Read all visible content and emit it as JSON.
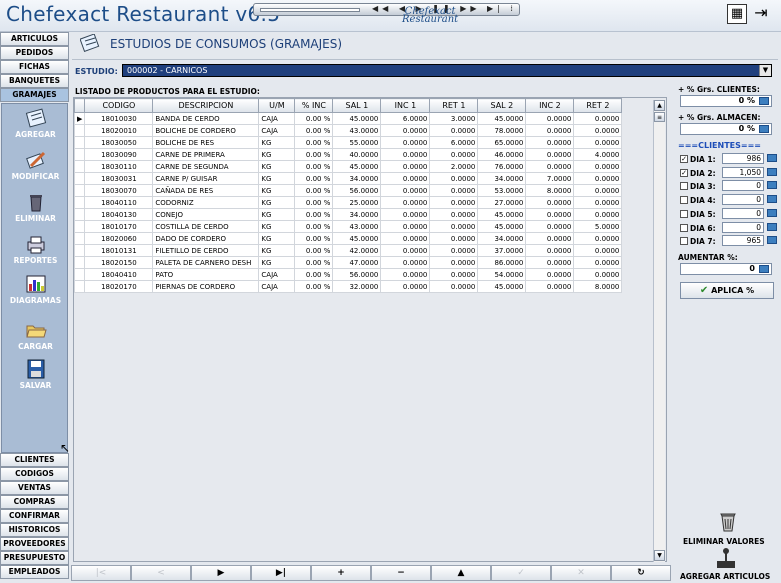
{
  "app": {
    "title": "Chefexact Restaurant v6.5",
    "logo": "Chefexact\nRestaurant"
  },
  "nav_top": [
    "ARTICULOS",
    "PEDIDOS",
    "FICHAS",
    "BANQUETES",
    "GRAMAJES"
  ],
  "nav_active": "GRAMAJES",
  "tools": [
    "AGREGAR",
    "MODIFICAR",
    "ELIMINAR",
    "REPORTES",
    "DIAGRAMAS",
    "CARGAR",
    "SALVAR"
  ],
  "nav_bottom": [
    "CLIENTES",
    "CODIGOS",
    "VENTAS",
    "COMPRAS",
    "CONFIRMAR",
    "HISTORICOS",
    "PROVEEDORES",
    "PRESUPUESTO",
    "EMPLEADOS"
  ],
  "screen": {
    "title": "ESTUDIOS DE CONSUMOS (GRAMAJES)",
    "estudio_label": "ESTUDIO:",
    "estudio_value": "000002 - CARNICOS",
    "listado_label": "LISTADO DE PRODUCTOS PARA EL ESTUDIO:"
  },
  "grid": {
    "columns": [
      "CODIGO",
      "DESCRIPCION",
      "U/M",
      "% INC",
      "SAL 1",
      "INC 1",
      "RET 1",
      "SAL 2",
      "INC 2",
      "RET 2"
    ],
    "rows": [
      [
        "18010030",
        "BANDA DE CERDO",
        "CAJA",
        "0.00 %",
        "45.0000",
        "6.0000",
        "3.0000",
        "45.0000",
        "0.0000",
        "0.0000"
      ],
      [
        "18020010",
        "BOLICHE DE CORDERO",
        "CAJA",
        "0.00 %",
        "43.0000",
        "0.0000",
        "0.0000",
        "78.0000",
        "0.0000",
        "0.0000"
      ],
      [
        "18030050",
        "BOLICHE DE RES",
        "KG",
        "0.00 %",
        "55.0000",
        "0.0000",
        "6.0000",
        "65.0000",
        "0.0000",
        "0.0000"
      ],
      [
        "18030090",
        "CARNE DE PRIMERA",
        "KG",
        "0.00 %",
        "40.0000",
        "0.0000",
        "0.0000",
        "46.0000",
        "0.0000",
        "4.0000"
      ],
      [
        "18030110",
        "CARNE DE SEGUNDA",
        "KG",
        "0.00 %",
        "45.0000",
        "0.0000",
        "2.0000",
        "76.0000",
        "0.0000",
        "0.0000"
      ],
      [
        "18030031",
        "CARNE P/ GUISAR",
        "KG",
        "0.00 %",
        "34.0000",
        "0.0000",
        "0.0000",
        "34.0000",
        "7.0000",
        "0.0000"
      ],
      [
        "18030070",
        "CAÑADA DE RES",
        "KG",
        "0.00 %",
        "56.0000",
        "0.0000",
        "0.0000",
        "53.0000",
        "8.0000",
        "0.0000"
      ],
      [
        "18040110",
        "CODORNIZ",
        "KG",
        "0.00 %",
        "25.0000",
        "0.0000",
        "0.0000",
        "27.0000",
        "0.0000",
        "0.0000"
      ],
      [
        "18040130",
        "CONEJO",
        "KG",
        "0.00 %",
        "34.0000",
        "0.0000",
        "0.0000",
        "45.0000",
        "0.0000",
        "0.0000"
      ],
      [
        "18010170",
        "COSTILLA DE CERDO",
        "KG",
        "0.00 %",
        "43.0000",
        "0.0000",
        "0.0000",
        "45.0000",
        "0.0000",
        "5.0000"
      ],
      [
        "18020060",
        "DADO DE CORDERO",
        "KG",
        "0.00 %",
        "45.0000",
        "0.0000",
        "0.0000",
        "34.0000",
        "0.0000",
        "0.0000"
      ],
      [
        "18010131",
        "FILETILLO DE CERDO",
        "KG",
        "0.00 %",
        "42.0000",
        "0.0000",
        "0.0000",
        "37.0000",
        "0.0000",
        "0.0000"
      ],
      [
        "18020150",
        "PALETA DE CARNERO DESH",
        "KG",
        "0.00 %",
        "47.0000",
        "0.0000",
        "0.0000",
        "86.0000",
        "0.0000",
        "0.0000"
      ],
      [
        "18040410",
        "PATO",
        "CAJA",
        "0.00 %",
        "56.0000",
        "0.0000",
        "0.0000",
        "54.0000",
        "0.0000",
        "0.0000"
      ],
      [
        "18020170",
        "PIERNAS DE CORDERO",
        "CAJA",
        "0.00 %",
        "32.0000",
        "0.0000",
        "0.0000",
        "45.0000",
        "0.0000",
        "8.0000"
      ]
    ]
  },
  "bottom_nav": [
    "|<",
    "<",
    "▶",
    "▶|",
    "+",
    "−",
    "▲",
    "✓",
    "✕",
    "↻"
  ],
  "right": {
    "pct_clientes_label": "+ % Grs. CLIENTES:",
    "pct_clientes_value": "0 %",
    "pct_almacen_label": "+ % Grs. ALMACEN:",
    "pct_almacen_value": "0 %",
    "clientes_sep": "===CLIENTES===",
    "dias": [
      {
        "label": "DIA 1:",
        "checked": true,
        "value": "986"
      },
      {
        "label": "DIA 2:",
        "checked": true,
        "value": "1,050"
      },
      {
        "label": "DIA 3:",
        "checked": false,
        "value": "0"
      },
      {
        "label": "DIA 4:",
        "checked": false,
        "value": "0"
      },
      {
        "label": "DIA 5:",
        "checked": false,
        "value": "0"
      },
      {
        "label": "DIA 6:",
        "checked": false,
        "value": "0"
      },
      {
        "label": "DIA 7:",
        "checked": false,
        "value": "965"
      }
    ],
    "aumentar_label": "AUMENTAR %:",
    "aumentar_value": "0",
    "aplica_label": "APLICA %",
    "eliminar_valores_label": "ELIMINAR VALORES",
    "agregar_articulos_label": "AGREGAR ARTICULOS"
  }
}
